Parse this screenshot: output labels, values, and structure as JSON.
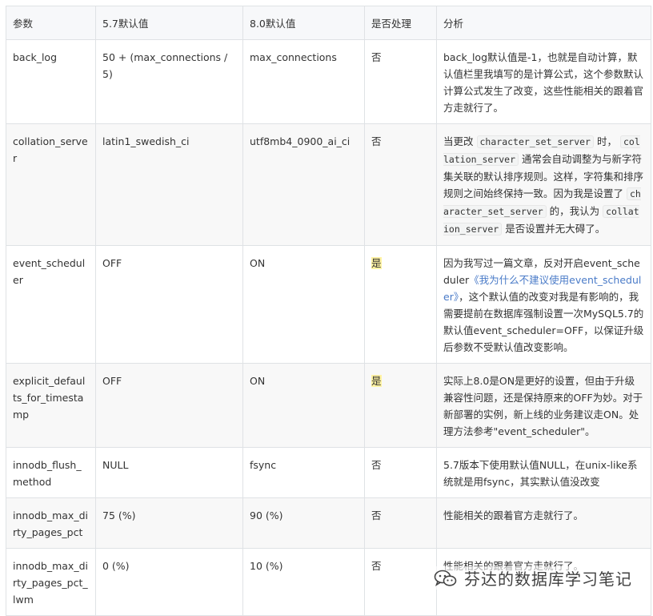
{
  "columns": [
    "参数",
    "5.7默认值",
    "8.0默认值",
    "是否处理",
    "分析"
  ],
  "rows": {
    "r0": {
      "param": "back_log",
      "v57": "50 + (max_connections / 5)",
      "v80": "max_connections",
      "handle": "否",
      "analysis": "back_log默认值是-1，也就是自动计算，默认值栏里我填写的是计算公式，这个参数默认计算公式发生了改变，这些性能相关的跟着官方走就行了。"
    },
    "r1": {
      "param": "collation_server",
      "v57": "latin1_swedish_ci",
      "v80": "utf8mb4_0900_ai_ci",
      "handle": "否",
      "a_t1": "当更改",
      "a_c1": "character_set_server",
      "a_t2": "时，",
      "a_c2": "collation_server",
      "a_t3": "通常会自动调整为与新字符集关联的默认排序规则。这样，字符集和排序规则之间始终保持一致。因为我是设置了",
      "a_c3": "character_set_server",
      "a_t4": "的，我认为",
      "a_c4": "collation_server",
      "a_t5": "是否设置并无大碍了。"
    },
    "r2": {
      "param": "event_scheduler",
      "v57": "OFF",
      "v80": "ON",
      "handle": "是",
      "a_t1": "因为我写过一篇文章，反对开启event_scheduler",
      "a_link": "《我为什么不建议使用event_scheduler》",
      "a_t2": "，这个默认值的改变对我是有影响的，我需要提前在数据库强制设置一次MySQL5.7的默认值event_scheduler=OFF，以保证升级后参数不受默认值改变影响。"
    },
    "r3": {
      "param": "explicit_defaults_for_timestamp",
      "v57": "OFF",
      "v80": "ON",
      "handle": "是",
      "analysis": "实际上8.0是ON是更好的设置，但由于升级兼容性问题，还是保持原来的OFF为妙。对于新部署的实例，新上线的业务建议走ON。处理方法参考\"event_scheduler\"。"
    },
    "r4": {
      "param": "innodb_flush_method",
      "v57": "NULL",
      "v80": "fsync",
      "handle": "否",
      "analysis": "5.7版本下使用默认值NULL，在unix-like系统就是用fsync，其实默认值没改变"
    },
    "r5": {
      "param": "innodb_max_dirty_pages_pct",
      "v57": "75 (%)",
      "v80": "90 (%)",
      "handle": "否",
      "analysis": "性能相关的跟着官方走就行了。"
    },
    "r6": {
      "param": "innodb_max_dirty_pages_pct_lwm",
      "v57": "0 (%)",
      "v80": "10 (%)",
      "handle": "否",
      "analysis": "性能相关的跟着官方走就行了。"
    }
  },
  "watermark": {
    "text": "芬达的数据库学习笔记",
    "icon": "wechat-icon"
  },
  "colors": {
    "border": "#dfe2e5",
    "highlight": "#fff3a3",
    "link": "#4a7bc8"
  }
}
